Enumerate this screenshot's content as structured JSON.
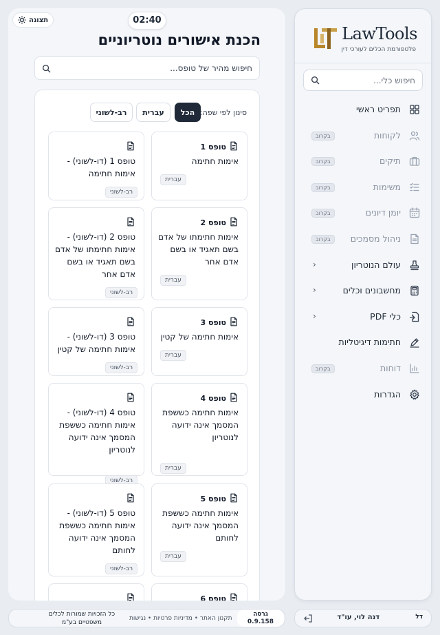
{
  "sidebar": {
    "brand_name": "LawTools",
    "brand_sub": "פלטפורמת הכלים לעורכי דין",
    "search_placeholder": "חיפוש כלי...",
    "soon_label": "בקרוב",
    "items": [
      {
        "label": "תפריט ראשי",
        "icon": "grid-icon",
        "state": "active"
      },
      {
        "label": "לקוחות",
        "icon": "users-icon",
        "state": "soon"
      },
      {
        "label": "תיקים",
        "icon": "briefcase-icon",
        "state": "soon"
      },
      {
        "label": "משימות",
        "icon": "tasks-icon",
        "state": "soon"
      },
      {
        "label": "יומן דיונים",
        "icon": "calendar-icon",
        "state": "soon"
      },
      {
        "label": "ניהול מסמכים",
        "icon": "document-icon",
        "state": "soon"
      },
      {
        "label": "עולם הנוטריון",
        "icon": "stamp-icon",
        "state": "expandable"
      },
      {
        "label": "מחשבונים וכלים",
        "icon": "calculator-icon",
        "state": "expandable"
      },
      {
        "label": "כלי PDF",
        "icon": "pdf-icon",
        "state": "expandable"
      },
      {
        "label": "חתימות דיגיטליות",
        "icon": "signature-icon",
        "state": "normal"
      },
      {
        "label": "דוחות",
        "icon": "chart-icon",
        "state": "soon"
      },
      {
        "label": "הגדרות",
        "icon": "gear-icon",
        "state": "normal"
      }
    ],
    "user_initials": "דל",
    "user_name": "דנה לוי, עו\"ד"
  },
  "header": {
    "timer": "02:40",
    "view_label": "תצוגה",
    "title": "הכנת אישורים נוטריוניים",
    "search_placeholder": "חיפוש מהיר של טופס..."
  },
  "filters": {
    "label": "סינון לפי שפה:",
    "options": [
      "הכל",
      "עברית",
      "רב-לשוני"
    ],
    "active": "הכל"
  },
  "cards": [
    {
      "num": "טופס 1",
      "text": "אימות חתימה",
      "lang": "עברית"
    },
    {
      "num": "",
      "text": "טופס 1 (דו-לשוני) - אימות חתימה",
      "lang": "רב-לשוני"
    },
    {
      "num": "טופס 2",
      "text": "אימות חתימתו של אדם בשם תאגיד או בשם אדם אחר",
      "lang": "עברית"
    },
    {
      "num": "",
      "text": "טופס 2 (דו-לשוני) - אימות חתימתו של אדם בשם תאגיד או בשם אדם אחר",
      "lang": "רב-לשוני"
    },
    {
      "num": "טופס 3",
      "text": "אימות חתימה של קטין",
      "lang": "עברית"
    },
    {
      "num": "",
      "text": "טופס 3 (דו-לשוני) - אימות חתימה של קטין",
      "lang": "רב-לשוני"
    },
    {
      "num": "טופס 4",
      "text": "אימות חתימה כששפת המסמך אינה ידועה לנוטריון",
      "lang": "עברית"
    },
    {
      "num": "",
      "text": "טופס 4 (דו-לשוני) - אימות חתימה כששפת המסמך אינה ידועה לנוטריון",
      "lang": "רב-לשוני"
    },
    {
      "num": "טופס 5",
      "text": "אימות חתימה כששפת המסמך אינה ידועה לחותם",
      "lang": "עברית"
    },
    {
      "num": "",
      "text": "טופס 5 (דו-לשוני) - אימות חתימה כששפת המסמך אינה ידועה לחותם",
      "lang": "רב-לשוני"
    },
    {
      "num": "טופס 6",
      "text": "",
      "lang": ""
    },
    {
      "num": "",
      "text": "",
      "lang": ""
    }
  ],
  "footer": {
    "version_label": "גרסה",
    "version": "0.9.158",
    "links": "תקנון האתר  •  מדיניות פרטיות  •  נגישות",
    "copyright": "כל הזכויות שמורות לכלים משפטיים בע\"מ"
  },
  "colors": {
    "accent_dark": "#1f2937",
    "brand_gold": "#b8862b",
    "background": "#e9edf2"
  }
}
